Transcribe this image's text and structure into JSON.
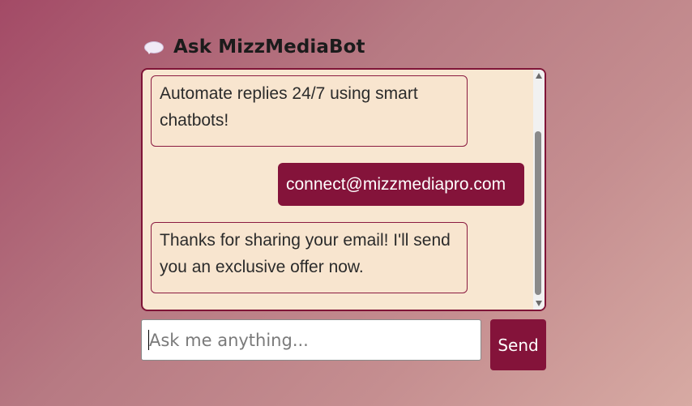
{
  "header": {
    "icon": "speech-bubble-icon",
    "title": "Ask MizzMediaBot"
  },
  "messages": [
    {
      "sender": "bot",
      "text": "Automate replies 24/7 using smart chatbots!"
    },
    {
      "sender": "user",
      "text": "connect@mizzmediapro.com"
    },
    {
      "sender": "bot",
      "text": "Thanks for sharing your email! I'll send you an exclusive offer now."
    }
  ],
  "input": {
    "placeholder": "Ask me anything...",
    "value": ""
  },
  "send_button": {
    "label": "Send"
  },
  "colors": {
    "accent": "#84133a",
    "chat_background": "#f8e7d1",
    "page_gradient_start": "#a34a66",
    "page_gradient_end": "#d7aaa3"
  }
}
